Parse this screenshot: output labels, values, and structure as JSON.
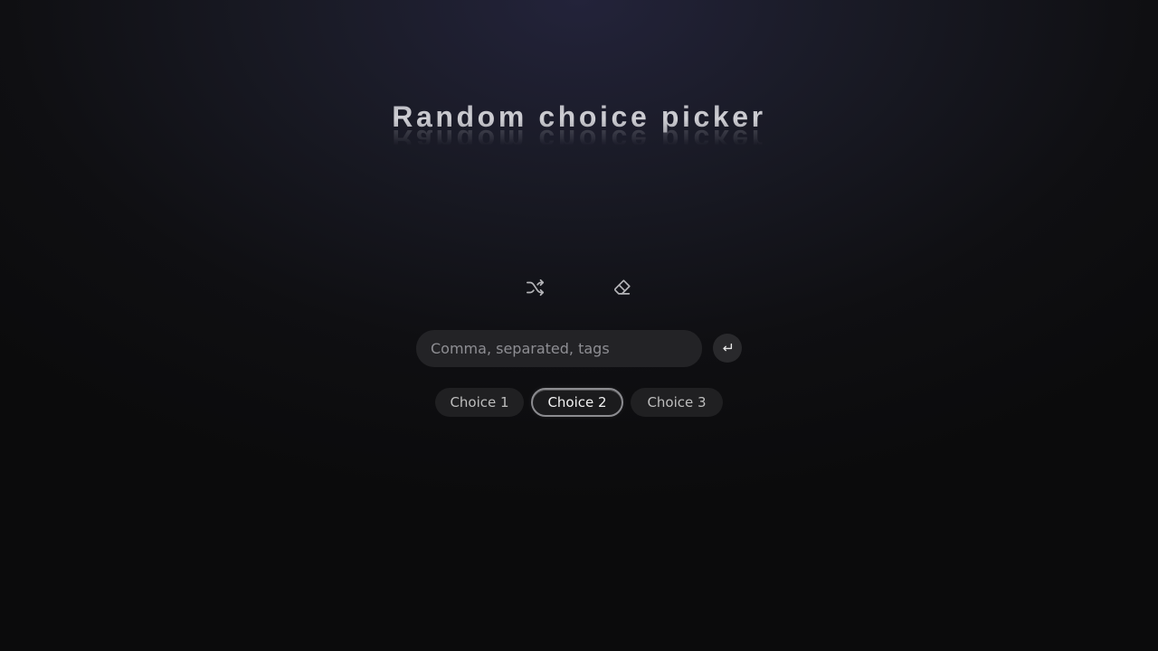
{
  "app": {
    "title": "Random choice picker"
  },
  "toolbar": {
    "shuffle_icon": "shuffle-icon",
    "clear_icon": "eraser-icon"
  },
  "input": {
    "placeholder": "Comma, separated, tags",
    "value": "",
    "submit_icon": "enter-return-icon"
  },
  "choices": [
    {
      "label": "Choice 1",
      "highlighted": false
    },
    {
      "label": "Choice 2",
      "highlighted": true
    },
    {
      "label": "Choice 3",
      "highlighted": false
    }
  ],
  "colors": {
    "background_top": "#23233a",
    "background_bottom": "#0b0b0c",
    "chip": "#202022",
    "chip_highlight_border": "#8c8c90",
    "input": "#232326"
  }
}
